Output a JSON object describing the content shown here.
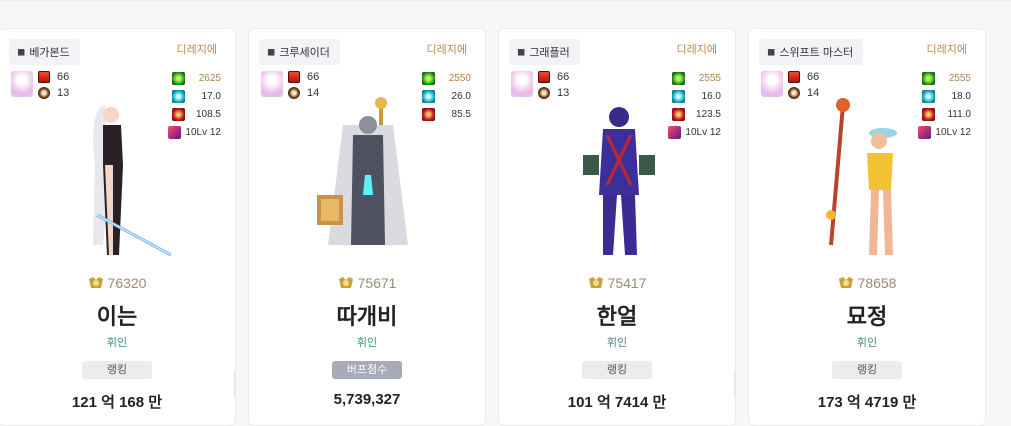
{
  "cards": [
    {
      "server": "베가본드",
      "adventure": "디레지에",
      "mini_values": [
        "66",
        "13"
      ],
      "stats": [
        "2625",
        "17.0",
        "108.5",
        "10Lv 12"
      ],
      "fame": "76320",
      "name": "이는",
      "job": "휘인",
      "badge": "랭킹",
      "score": "121 억 168 만"
    },
    {
      "server": "크루세이더",
      "adventure": "디레지에",
      "mini_values": [
        "66",
        "14"
      ],
      "stats": [
        "2550",
        "26.0",
        "85.5"
      ],
      "fame": "75671",
      "name": "따개비",
      "job": "휘인",
      "badge": "버프점수",
      "score": "5,739,327"
    },
    {
      "server": "그래플러",
      "adventure": "디레지에",
      "mini_values": [
        "66",
        "13"
      ],
      "stats": [
        "2555",
        "16.0",
        "123.5",
        "10Lv 12"
      ],
      "fame": "75417",
      "name": "한얼",
      "job": "휘인",
      "badge": "랭킹",
      "score": "101 억 7414 만"
    },
    {
      "server": "스위프트 마스터",
      "adventure": "디레지에",
      "mini_values": [
        "66",
        "14"
      ],
      "stats": [
        "2555",
        "18.0",
        "111.0",
        "10Lv 12"
      ],
      "fame": "78658",
      "name": "묘정",
      "job": "휘인",
      "badge": "랭킹",
      "score": "173 억 4719 만"
    }
  ],
  "icons": {
    "server": "badge-icon",
    "fame": "fame-medal-icon",
    "stats": [
      "green-orb-icon",
      "cyan-orb-icon",
      "red-cross-icon",
      "purple-rune-icon"
    ]
  }
}
